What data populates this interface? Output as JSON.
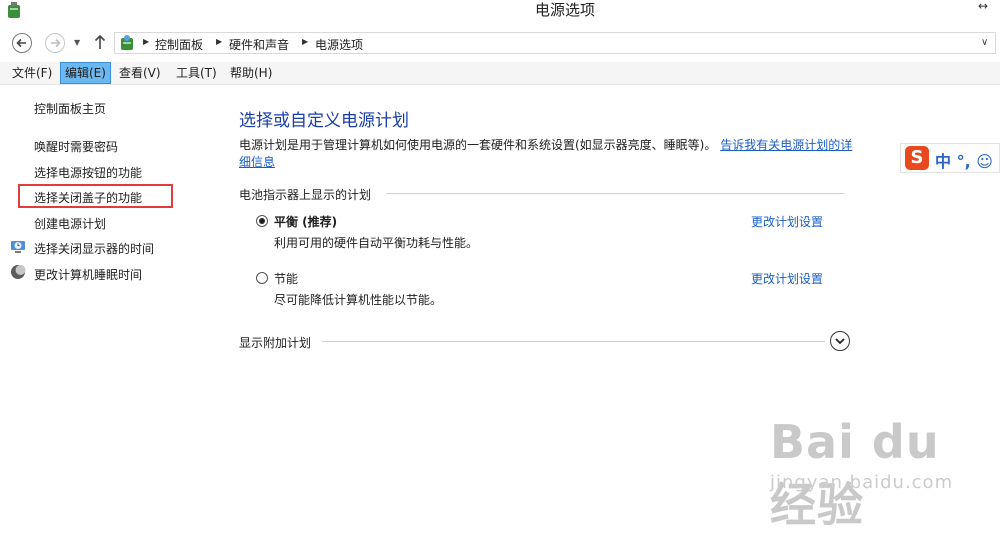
{
  "window": {
    "title": "电源选项",
    "resize_glyph": "↔"
  },
  "address": {
    "breadcrumb": [
      "控制面板",
      "硬件和声音",
      "电源选项"
    ],
    "dropdown_glyph": "∨"
  },
  "menu": [
    "文件(F)",
    "编辑(E)",
    "查看(V)",
    "工具(T)",
    "帮助(H)"
  ],
  "menu_active_index": 1,
  "sidebar": {
    "home": "控制面板主页",
    "links": [
      "唤醒时需要密码",
      "选择电源按钮的功能",
      "选择关闭盖子的功能",
      "创建电源计划",
      "选择关闭显示器的时间",
      "更改计算机睡眠时间"
    ]
  },
  "main": {
    "title": "选择或自定义电源计划",
    "description": "电源计划是用于管理计算机如何使用电源的一套硬件和系统设置(如显示器亮度、睡眠等)。",
    "help_link": "告诉我有关电源计划的详细信息",
    "battery_section": "电池指示器上显示的计划",
    "plans": [
      {
        "name": "平衡 (推荐)",
        "description": "利用可用的硬件自动平衡功耗与性能。",
        "selected": true,
        "link": "更改计划设置"
      },
      {
        "name": "节能",
        "description": "尽可能降低计算机性能以节能。",
        "selected": false,
        "link": "更改计划设置"
      }
    ],
    "extra_section": "显示附加计划"
  },
  "ime": {
    "logo": "S",
    "text": "中 °, ☺"
  },
  "watermark": {
    "text": "Bai du 经验",
    "url": "jingyan.baidu.com"
  },
  "colors": {
    "link": "#1a5fc7",
    "title": "#1a3ea8",
    "highlight": "#e23b3b",
    "menu_active": "#6bb7f0"
  }
}
